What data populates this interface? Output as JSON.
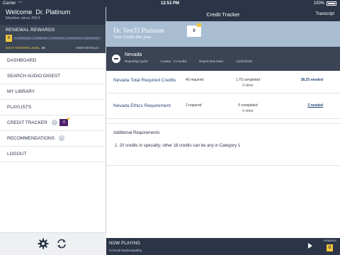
{
  "status_bar": {
    "carrier": "Carrier",
    "time": "12:53 PM",
    "battery": "100%"
  },
  "sidebar": {
    "welcome_prefix": "Welcome",
    "user_name": "Dr. Platinum",
    "member_since": "Member since 2014",
    "rewards": {
      "title": "RENEWAL REWARDS",
      "current_level": "0",
      "levels": [
        "LEVEL 25",
        "LEVEL 50",
        "LEVEL 75",
        "LEVEL 100",
        "LEVEL 125"
      ],
      "next_label": "NEXT REWARD LEVEL:",
      "next_value": "25",
      "view_details": "VIEW DETAILS ›"
    },
    "items": [
      {
        "label": "DASHBOARD"
      },
      {
        "label": "SEARCH AUDIO DIGEST"
      },
      {
        "label": "MY LIBRARY"
      },
      {
        "label": "PLAYLISTS"
      },
      {
        "label": "CREDIT TRACKER",
        "badge": "2",
        "flag": "0"
      },
      {
        "label": "RECOMMENDATIONS",
        "badge": "10"
      },
      {
        "label": "LOGOUT"
      }
    ],
    "footer_icons": [
      "gear-icon",
      "sync-icon"
    ]
  },
  "header": {
    "title": "Credit Tracker",
    "transcript": "Transcript"
  },
  "user_band": {
    "name": "Dr. Test33 Platinum",
    "subtitle": "Your Credits this year:",
    "credits": "0"
  },
  "state": {
    "name": "Nevada",
    "reporting_cycle_label": "Reporting Cycle:",
    "reporting_cycle_value": "2 years · 0 months",
    "report_due_label": "Report Due Date:",
    "report_due_value": "12/31/2015"
  },
  "requirements": [
    {
      "name": "Nevada Total Required Credits",
      "required": "40 required",
      "completed": "1.75 completed",
      "other": "0 other",
      "needed": "38.25 needed"
    },
    {
      "name": "Nevada Ethics Requirement",
      "required": "2 required",
      "completed": "0 completed",
      "other": "0 other",
      "needed": "2 needed"
    }
  ],
  "additional": {
    "heading": "Additional Requirements",
    "items": [
      "1.  20 credits in specialty; other 18 credits can be any in Category 1"
    ]
  },
  "now_playing": {
    "label": "NOW PLAYING",
    "track": "Cervical Radiculopathy",
    "rewards_label": "REWARDS",
    "rewards_level": "0"
  },
  "colors": {
    "navy": "#2b3547",
    "slate": "#3b4455",
    "band": "#a8bdd2",
    "gold": "#f3c63c",
    "purple": "#4b1f6b",
    "link": "#27477a"
  }
}
